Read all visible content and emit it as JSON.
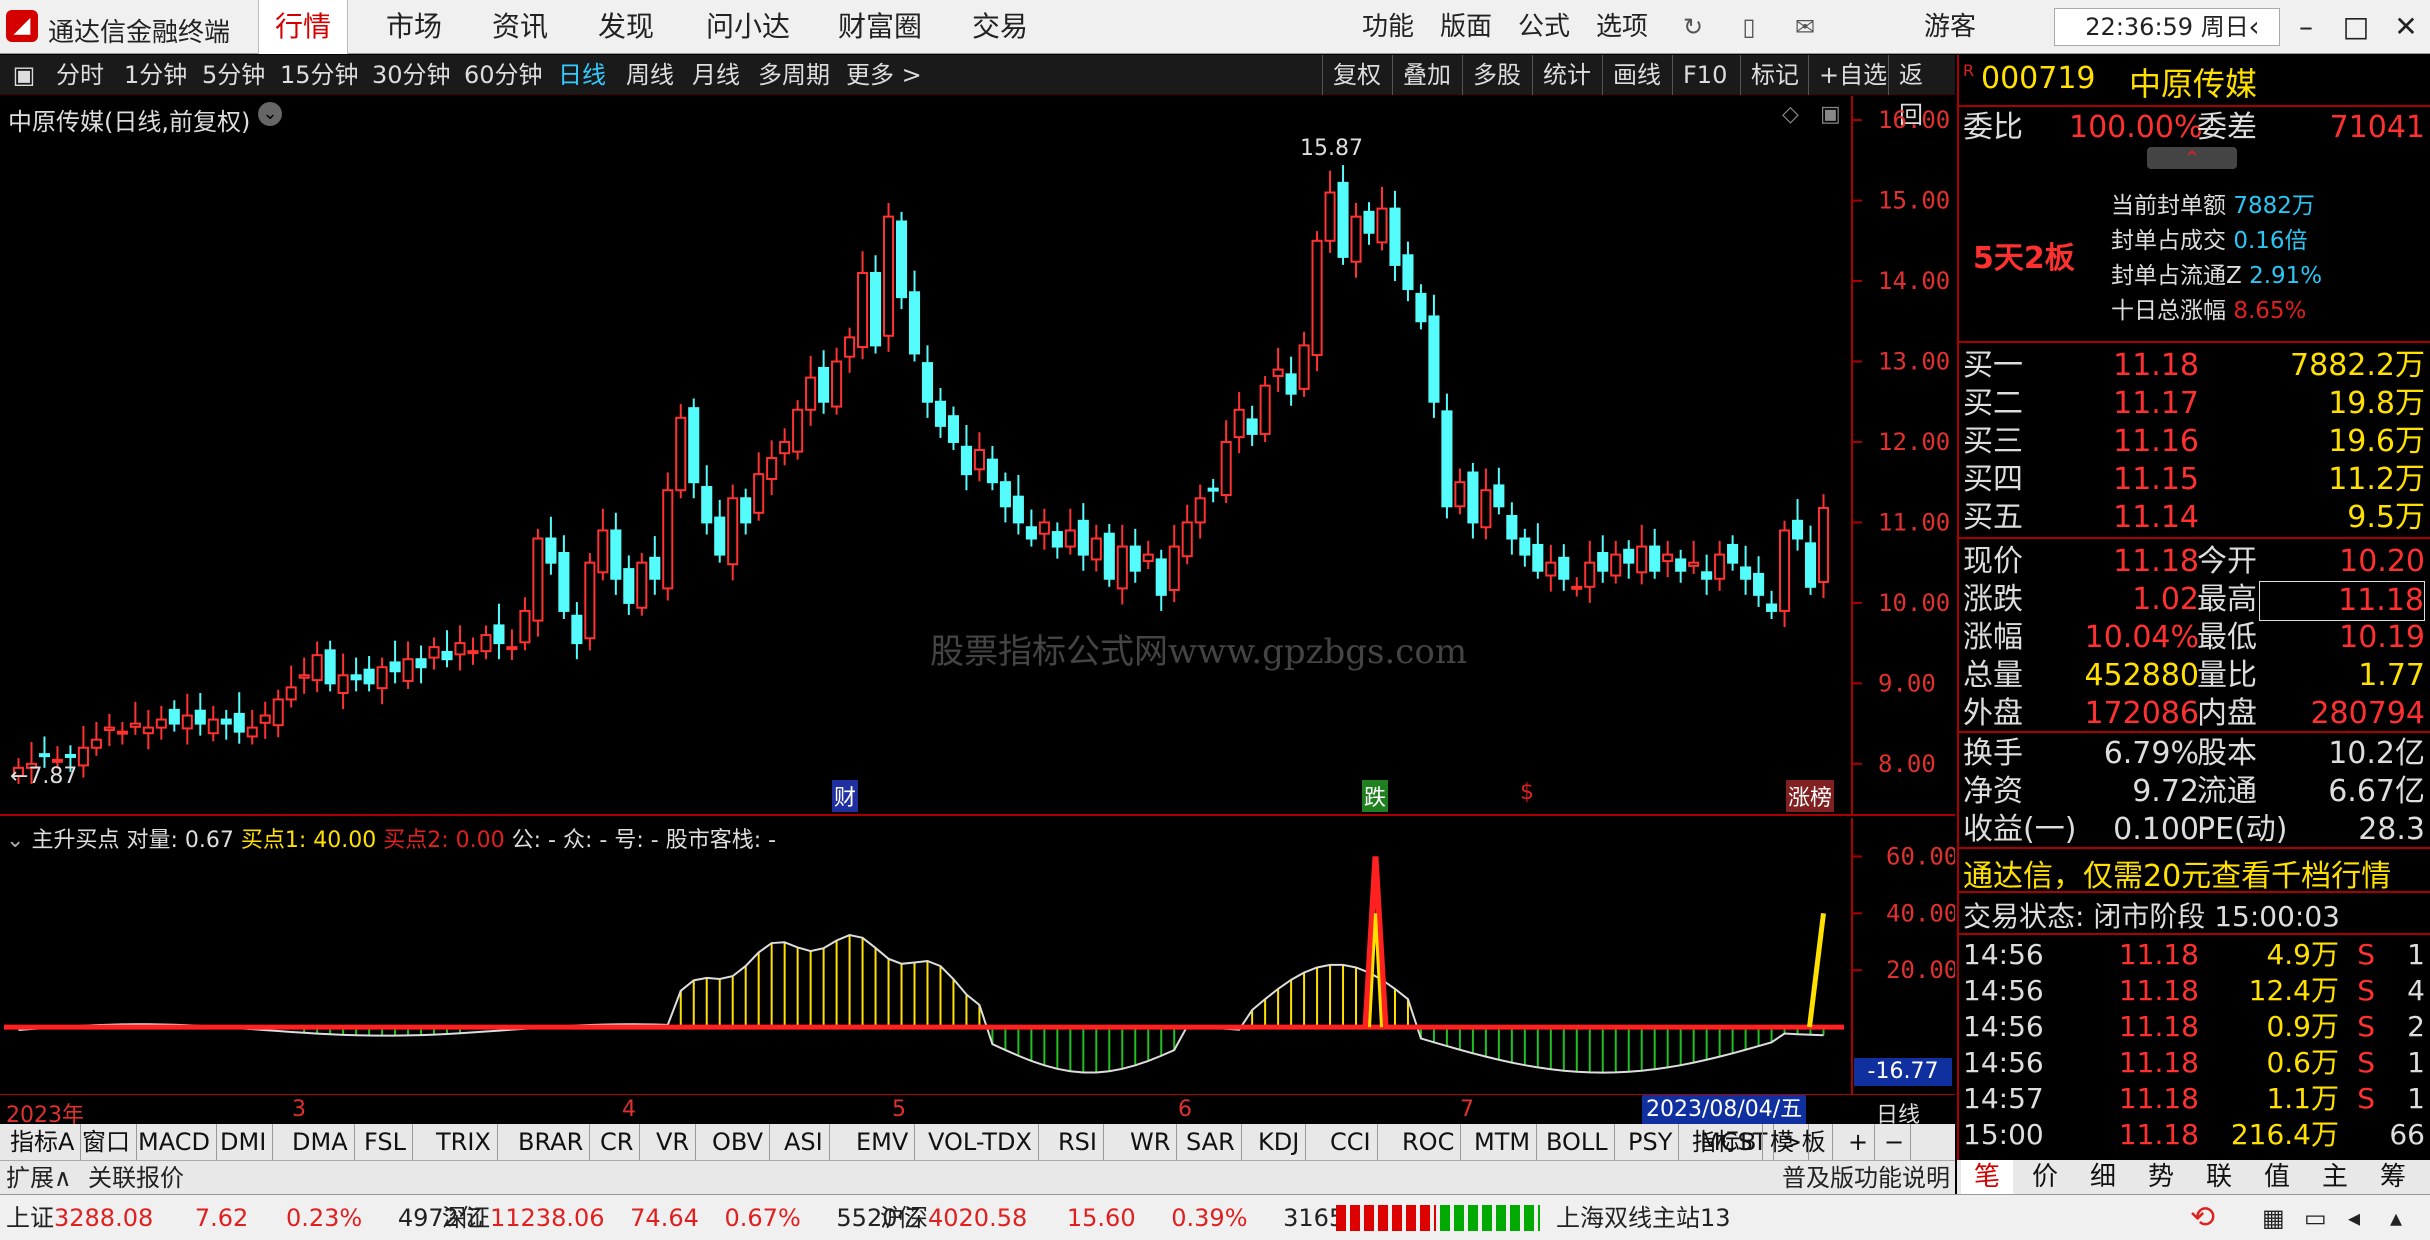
{
  "app": {
    "title": "通达信金融终端",
    "nav": [
      "行情",
      "市场",
      "资讯",
      "发现",
      "问小达",
      "财富圈",
      "交易"
    ],
    "active_nav": "行情",
    "right_menu": [
      "功能",
      "版面",
      "公式",
      "选项"
    ],
    "user": "游客",
    "clock": "22:36:59 周日"
  },
  "period_bar": {
    "periods": [
      "分时",
      "1分钟",
      "5分钟",
      "15分钟",
      "30分钟",
      "60分钟",
      "日线",
      "周线",
      "月线",
      "多周期",
      "更多 >"
    ],
    "selected": "日线",
    "tools": [
      "复权",
      "叠加",
      "多股",
      "统计",
      "画线",
      "F10",
      "标记",
      "+自选",
      "返回"
    ]
  },
  "main_chart": {
    "label": "中原传媒(日线,前复权)",
    "watermark": "股票指标公式网www.gpzbgs.com",
    "high_label": "15.87",
    "low_label": "7.87",
    "event_markers": [
      "财",
      "跌",
      "$",
      "涨榜"
    ]
  },
  "indicator": {
    "label": "主升买点",
    "fields": [
      "对量: 0.67",
      "买点1: 40.00",
      "买点2: 0.00",
      "公: -",
      "众: -",
      "号: -",
      "股市客栈: -"
    ],
    "current_value": "-16.77"
  },
  "date_axis": {
    "labels": [
      "2023年",
      "3",
      "4",
      "5",
      "6",
      "7"
    ],
    "cursor_date": "2023/08/04/五",
    "period_label": "日线"
  },
  "indicator_tabs": [
    "指标A",
    "窗口",
    "MACD",
    "DMI",
    "DMA",
    "FSL",
    "TRIX",
    "BRAR",
    "CR",
    "VR",
    "OBV",
    "ASI",
    "EMV",
    "VOL-TDX",
    "RSI",
    "WR",
    "SAR",
    "KDJ",
    "CCI",
    "ROC",
    "MTM",
    "BOLL",
    "PSY",
    "MCST",
    ">"
  ],
  "indicator_tabs_right": [
    "指标B",
    "模 板",
    "+",
    "−"
  ],
  "ext_bar": {
    "left": [
      "扩展∧",
      "关联报价"
    ],
    "right": "普及版功能说明"
  },
  "status_bar": {
    "items": [
      {
        "name": "上证",
        "value": "3288.08",
        "change": "7.62",
        "pct": "0.23%",
        "amount": "4972亿"
      },
      {
        "name": "深证",
        "value": "11238.06",
        "change": "74.64",
        "pct": "0.67%",
        "amount": "5520亿"
      },
      {
        "name": "沪深",
        "value": "4020.58",
        "change": "15.60",
        "pct": "0.39%",
        "amount": "3165亿"
      }
    ],
    "server": "上海双线主站13"
  },
  "quote": {
    "code": "000719",
    "name": "中原传媒",
    "weibi_label": "委比",
    "weibi": "100.00%",
    "weicha_label": "委差",
    "weicha": "71041",
    "board_tag": "5天2板",
    "seal": [
      {
        "label": "当前封单额",
        "value": "7882万"
      },
      {
        "label": "封单占成交",
        "value": "0.16倍"
      },
      {
        "label": "封单占流通Z",
        "value": "2.91%"
      },
      {
        "label": "十日总涨幅",
        "value": "8.65%"
      }
    ],
    "bids": [
      {
        "label": "买一",
        "price": "11.18",
        "vol": "7882.2万"
      },
      {
        "label": "买二",
        "price": "11.17",
        "vol": "19.8万"
      },
      {
        "label": "买三",
        "price": "11.16",
        "vol": "19.6万"
      },
      {
        "label": "买四",
        "price": "11.15",
        "vol": "11.2万"
      },
      {
        "label": "买五",
        "price": "11.14",
        "vol": "9.5万"
      }
    ],
    "stats": [
      {
        "l1": "现价",
        "v1": "11.18",
        "l2": "今开",
        "v2": "10.20"
      },
      {
        "l1": "涨跌",
        "v1": "1.02",
        "l2": "最高",
        "v2": "11.18"
      },
      {
        "l1": "涨幅",
        "v1": "10.04%",
        "l2": "最低",
        "v2": "10.19"
      },
      {
        "l1": "总量",
        "v1": "452880",
        "l2": "量比",
        "v2": "1.77"
      },
      {
        "l1": "外盘",
        "v1": "172086",
        "l2": "内盘",
        "v2": "280794"
      }
    ],
    "fund": [
      {
        "l1": "换手",
        "v1": "6.79%",
        "l2": "股本",
        "v2": "10.2亿"
      },
      {
        "l1": "净资",
        "v1": "9.72",
        "l2": "流通",
        "v2": "6.67亿"
      },
      {
        "l1": "收益(一)",
        "v1": "0.100",
        "l2": "PE(动)",
        "v2": "28.3"
      }
    ],
    "promo": "通达信，仅需20元查看千档行情",
    "trade_status": "交易状态: 闭市阶段 15:00:03",
    "ticks": [
      {
        "t": "14:56",
        "p": "11.18",
        "v": "4.9万",
        "s": "S",
        "n": "1"
      },
      {
        "t": "14:56",
        "p": "11.18",
        "v": "12.4万",
        "s": "S",
        "n": "4"
      },
      {
        "t": "14:56",
        "p": "11.18",
        "v": "0.9万",
        "s": "S",
        "n": "2"
      },
      {
        "t": "14:56",
        "p": "11.18",
        "v": "0.6万",
        "s": "S",
        "n": "1"
      },
      {
        "t": "14:57",
        "p": "11.18",
        "v": "1.1万",
        "s": "S",
        "n": "1"
      },
      {
        "t": "15:00",
        "p": "11.18",
        "v": "216.4万",
        "s": "",
        "n": "66"
      }
    ],
    "bottom_tabs": [
      "笔",
      "价",
      "细",
      "势",
      "联",
      "值",
      "主",
      "筹"
    ]
  },
  "chart_data": {
    "type": "candlestick",
    "price_axis": [
      16.0,
      15.0,
      14.0,
      13.0,
      12.0,
      11.0,
      10.0,
      9.0,
      8.0
    ],
    "ylim": [
      7.6,
      16.2
    ],
    "closes": [
      7.95,
      8.0,
      8.1,
      8.05,
      8.1,
      8.2,
      8.3,
      8.45,
      8.4,
      8.5,
      8.45,
      8.55,
      8.5,
      8.6,
      8.5,
      8.55,
      8.5,
      8.4,
      8.45,
      8.6,
      8.8,
      8.95,
      9.1,
      9.35,
      9.0,
      9.1,
      9.05,
      9.0,
      9.2,
      9.15,
      9.3,
      9.2,
      9.45,
      9.3,
      9.5,
      9.4,
      9.6,
      9.5,
      9.45,
      9.9,
      10.8,
      10.5,
      9.9,
      9.5,
      10.5,
      10.9,
      10.3,
      10.0,
      10.5,
      10.3,
      11.4,
      12.3,
      11.5,
      11.0,
      10.6,
      11.3,
      11.0,
      11.6,
      11.8,
      12.0,
      12.4,
      12.8,
      12.5,
      13.0,
      13.3,
      14.1,
      13.2,
      14.8,
      13.8,
      13.1,
      12.5,
      12.2,
      12.0,
      11.6,
      11.9,
      11.5,
      11.2,
      11.0,
      10.8,
      11.0,
      10.7,
      10.9,
      10.6,
      10.8,
      10.3,
      10.7,
      10.4,
      10.6,
      10.1,
      10.7,
      11.0,
      11.3,
      11.4,
      12.0,
      12.4,
      12.1,
      12.7,
      12.9,
      12.6,
      13.2,
      14.5,
      15.1,
      14.3,
      14.8,
      14.6,
      14.9,
      14.2,
      13.9,
      13.5,
      12.5,
      11.2,
      11.5,
      11.0,
      11.4,
      11.2,
      10.8,
      10.6,
      10.4,
      10.5,
      10.3,
      10.2,
      10.5,
      10.4,
      10.6,
      10.5,
      10.7,
      10.4,
      10.6,
      10.4,
      10.5,
      10.3,
      10.6,
      10.5,
      10.3,
      10.1,
      9.9,
      10.9,
      10.8,
      10.2,
      11.18
    ],
    "indicator_lines": {
      "buy1_final": 40.0,
      "buy2": 0.0,
      "ylim": [
        -20,
        70
      ],
      "axis": [
        60.0,
        40.0,
        20.0
      ]
    }
  }
}
